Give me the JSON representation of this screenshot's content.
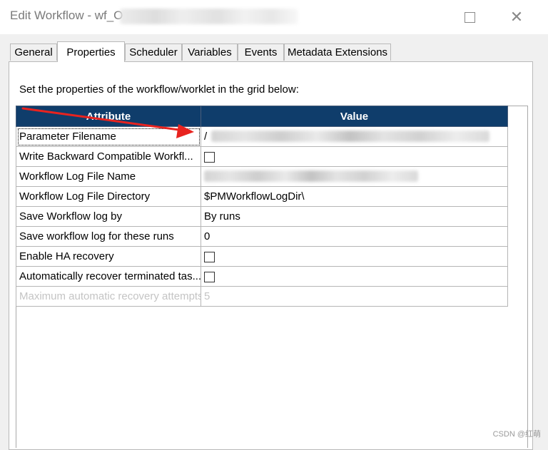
{
  "window": {
    "title": "Edit Workflow - wf_O",
    "maximize_label": "",
    "close_label": "✕"
  },
  "tabs": [
    {
      "label": "General"
    },
    {
      "label": "Properties"
    },
    {
      "label": "Scheduler"
    },
    {
      "label": "Variables"
    },
    {
      "label": "Events"
    },
    {
      "label": "Metadata Extensions"
    }
  ],
  "active_tab": "Properties",
  "instruction": "Set the properties of the workflow/worklet in the grid below:",
  "grid": {
    "headers": {
      "attribute": "Attribute",
      "value": "Value"
    },
    "rows": [
      {
        "attribute": "Parameter Filename",
        "value": "/",
        "type": "text"
      },
      {
        "attribute": "Write Backward Compatible Workfl...",
        "value": "",
        "type": "checkbox",
        "checked": false
      },
      {
        "attribute": "Workflow Log File Name",
        "value": "",
        "type": "text"
      },
      {
        "attribute": "Workflow Log File Directory",
        "value": "$PMWorkflowLogDir\\",
        "type": "text"
      },
      {
        "attribute": "Save Workflow log by",
        "value": "By runs",
        "type": "text"
      },
      {
        "attribute": "Save workflow log for these runs",
        "value": "0",
        "type": "text"
      },
      {
        "attribute": "Enable HA recovery",
        "value": "",
        "type": "checkbox",
        "checked": false
      },
      {
        "attribute": "Automatically recover terminated tas...",
        "value": "",
        "type": "checkbox",
        "checked": false
      },
      {
        "attribute": "Maximum automatic recovery attempts",
        "value": "5",
        "type": "text",
        "disabled": true
      }
    ]
  },
  "annotation": {
    "color": "#e8231f"
  },
  "watermark": "CSDN @红萌"
}
